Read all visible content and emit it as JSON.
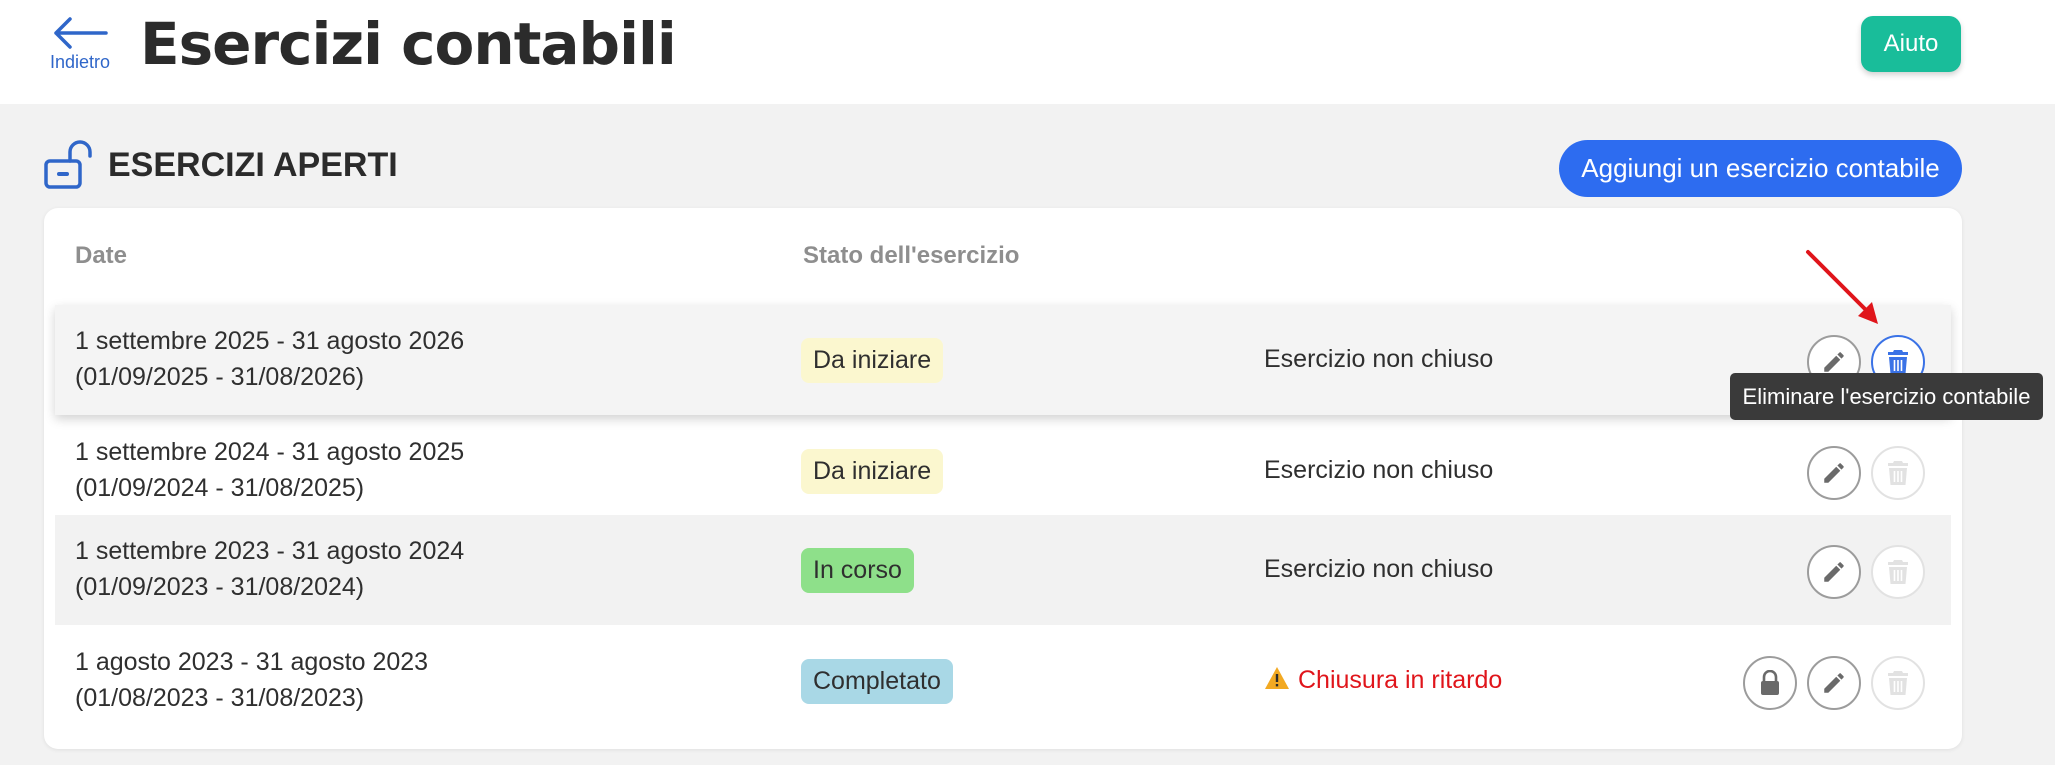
{
  "header": {
    "back_label": "Indietro",
    "title": "Esercizi contabili",
    "help_label": "Aiuto"
  },
  "section": {
    "title": "ESERCIZI APERTI",
    "add_label": "Aggiungi un esercizio contabile"
  },
  "table": {
    "columns": [
      "Date",
      "Stato dell'esercizio"
    ],
    "rows": [
      {
        "date_long": "1 settembre 2025 - 31 agosto 2026",
        "date_short": "(01/09/2025 - 31/08/2026)",
        "status": "Da iniziare",
        "closure": "Esercizio non chiuso"
      },
      {
        "date_long": "1 settembre 2024 - 31 agosto 2025",
        "date_short": "(01/09/2024 - 31/08/2025)",
        "status": "Da iniziare",
        "closure": "Esercizio non chiuso"
      },
      {
        "date_long": "1 settembre 2023 - 31 agosto 2024",
        "date_short": "(01/09/2023 - 31/08/2024)",
        "status": "In corso",
        "closure": "Esercizio non chiuso"
      },
      {
        "date_long": "1 agosto 2023 - 31 agosto 2023",
        "date_short": "(01/08/2023 - 31/08/2023)",
        "status": "Completato",
        "closure": "Chiusura in ritardo"
      }
    ]
  },
  "tooltip": "Eliminare l'esercizio contabile",
  "colors": {
    "accent_blue": "#2d6cf0",
    "help_green": "#19bd9a",
    "status_to_start": "#fbf7cf",
    "status_in_progress": "#8ee08a",
    "status_completed": "#a9d8e6",
    "late_red": "#e0151b",
    "annotation_arrow": "#e0151b"
  },
  "icons": [
    "back-arrow-icon",
    "unlocked-padlock-icon",
    "pencil-icon",
    "trash-icon",
    "lock-icon",
    "warning-icon"
  ]
}
